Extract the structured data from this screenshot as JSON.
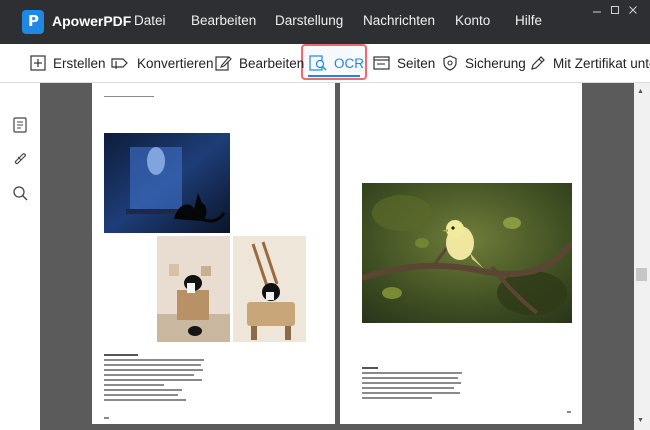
{
  "app": {
    "name": "ApowerPDF",
    "logo_letter": "P"
  },
  "menu": [
    "Datei",
    "Bearbeiten",
    "Darstellung",
    "Nachrichten",
    "Konto",
    "Hilfe"
  ],
  "window_controls": [
    "minimize-icon",
    "restore-icon",
    "close-icon"
  ],
  "toolbar": {
    "items": [
      {
        "label": "Erstellen",
        "icon": "plus-square-icon"
      },
      {
        "label": "Konvertieren",
        "icon": "convert-icon"
      },
      {
        "label": "Bearbeiten",
        "icon": "edit-icon"
      },
      {
        "label": "OCR",
        "icon": "ocr-icon",
        "active": true
      },
      {
        "label": "Seiten",
        "icon": "pages-icon"
      },
      {
        "label": "Sicherung",
        "icon": "shield-icon"
      },
      {
        "label": "Mit Zertifikat unter",
        "icon": "certificate-pen-icon"
      }
    ]
  },
  "sidebar": [
    "bookmark-icon",
    "attachment-icon",
    "search-icon"
  ],
  "colors": {
    "accent": "#1e88e5",
    "highlight": "#f06a6a",
    "titlebar": "#2e2f33",
    "doc_background": "#5b5b5b"
  }
}
